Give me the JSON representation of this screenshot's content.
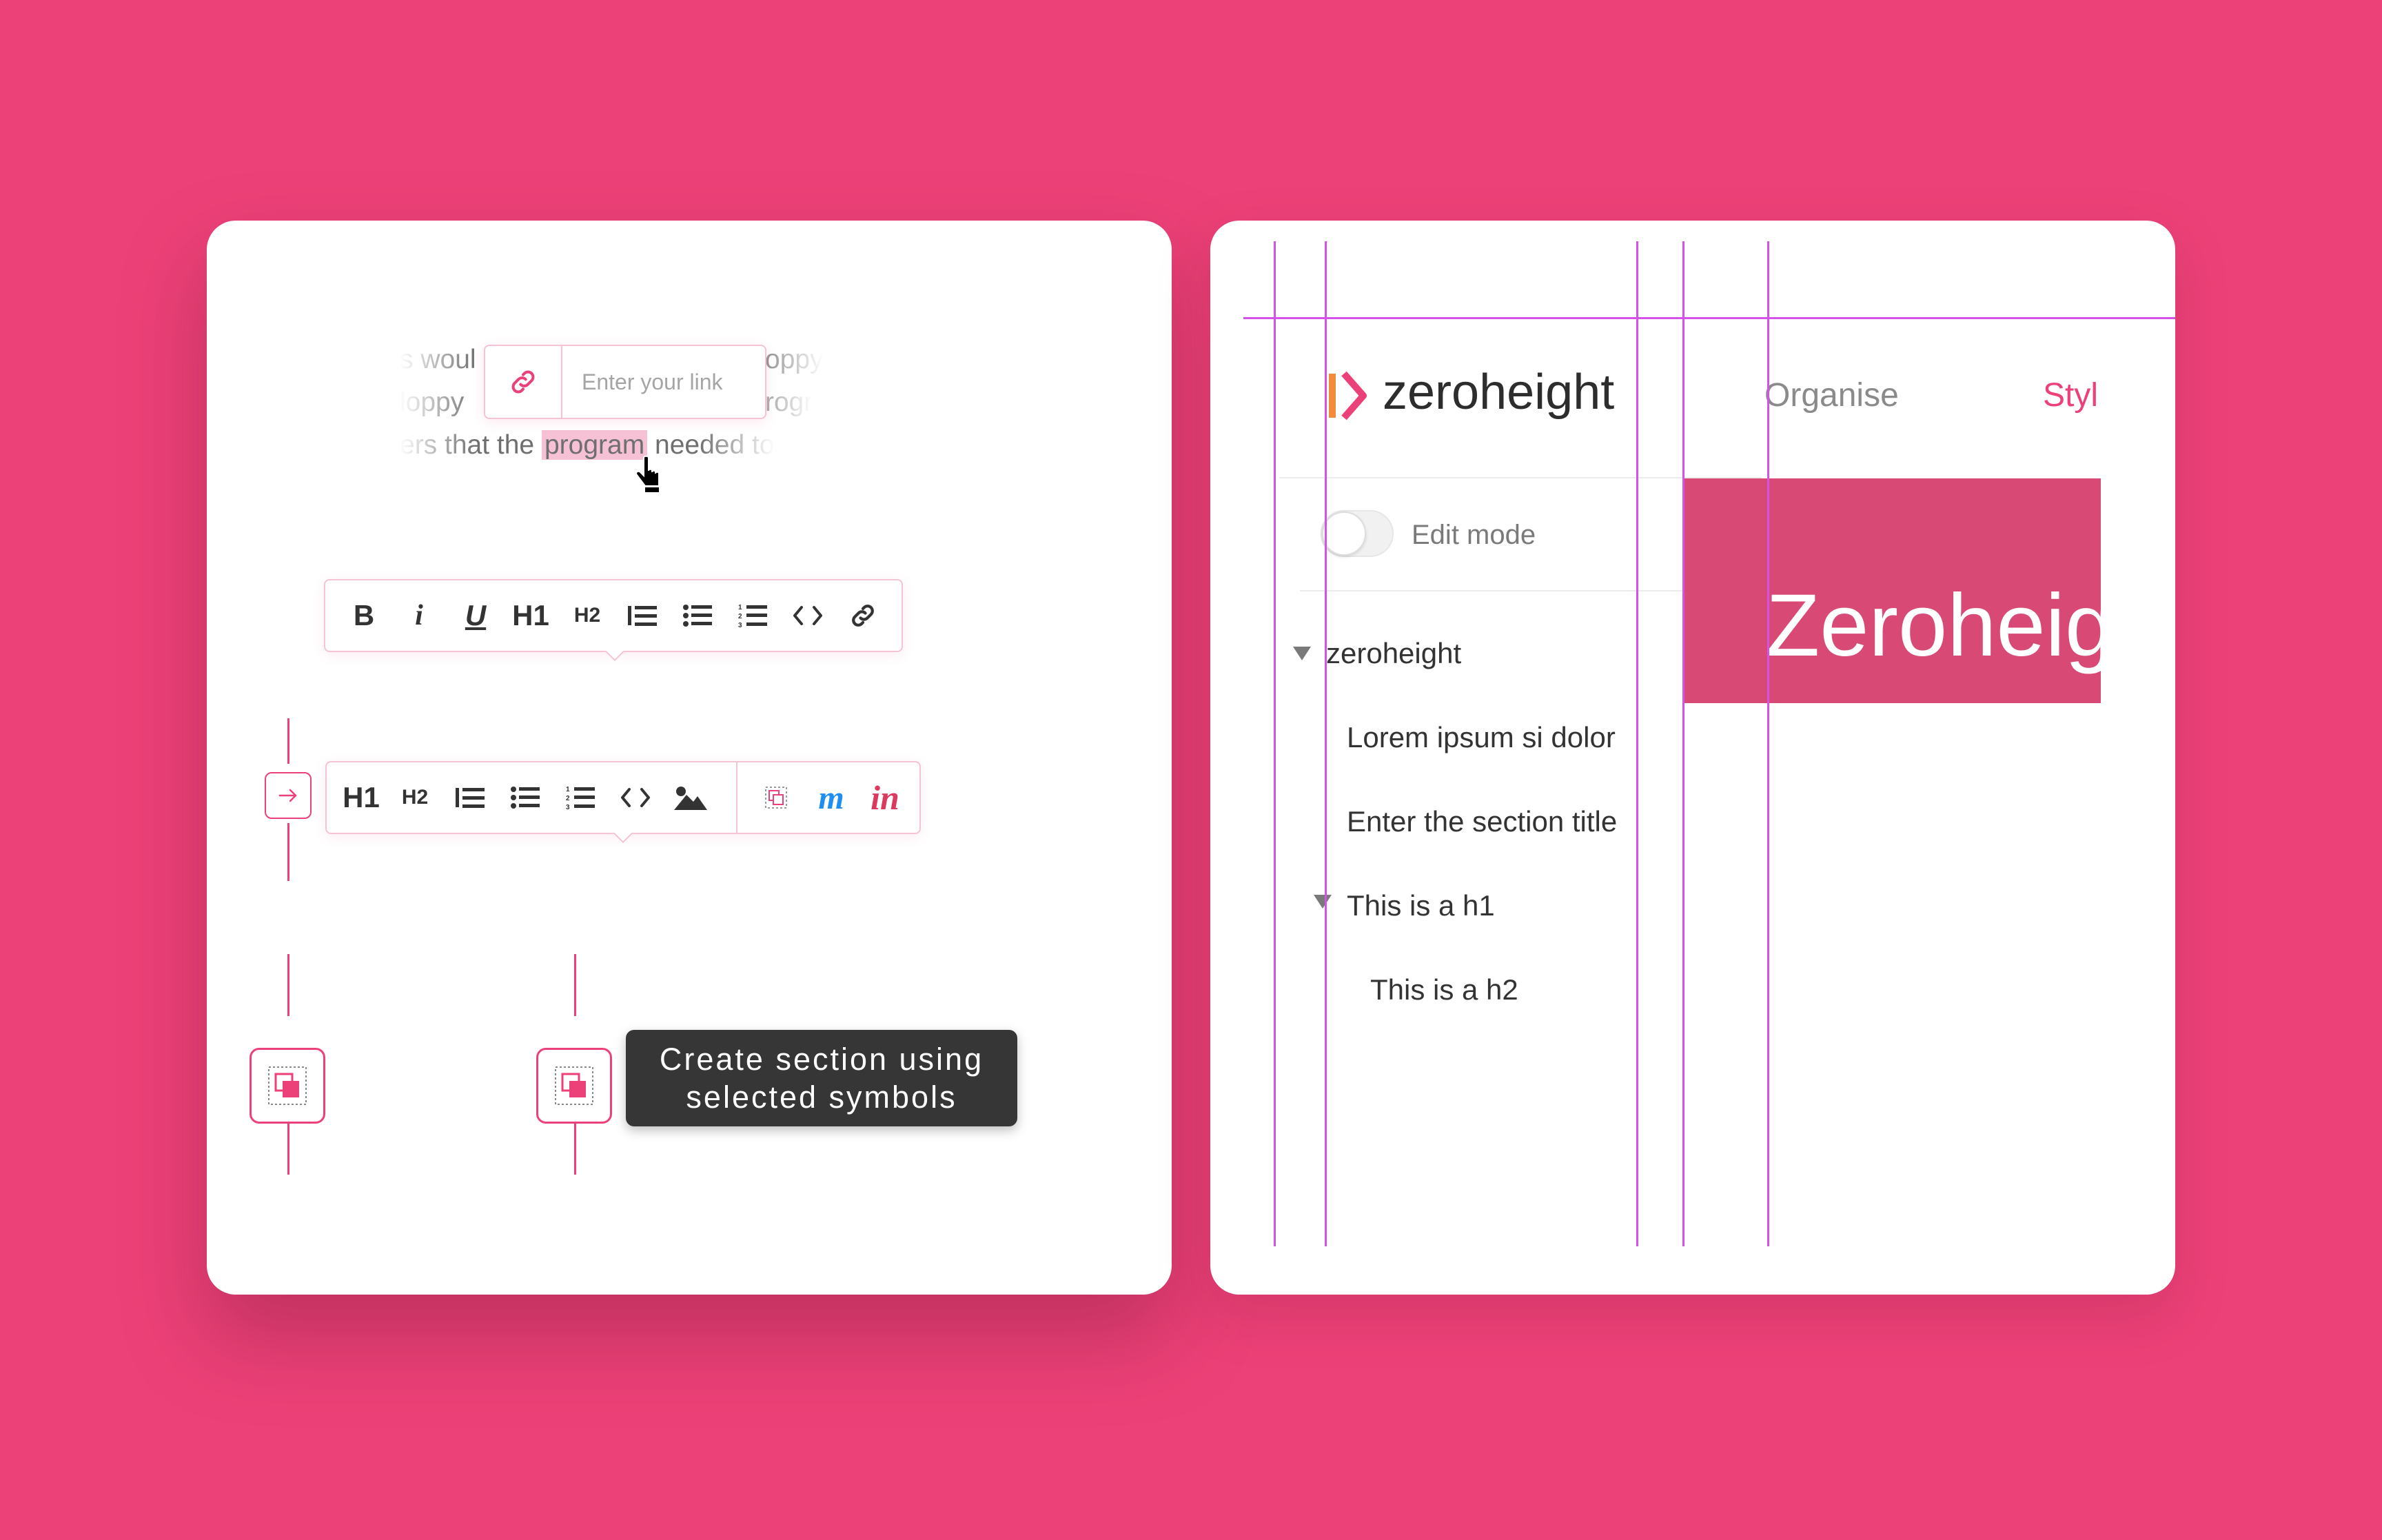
{
  "left_card": {
    "editor_text": {
      "line1_left": "s woul",
      "line1_right": "oppy",
      "line2_left": "loppy",
      "line2_right": "rogr",
      "line3_before": "ers that the",
      "line3_highlight": "program",
      "line3_after": "needed to"
    },
    "link_popover": {
      "placeholder": "Enter your link",
      "icon": "link-icon"
    },
    "formatting_toolbar": {
      "items": [
        {
          "label": "B",
          "icon": "bold-icon"
        },
        {
          "label": "i",
          "icon": "italic-icon"
        },
        {
          "label": "U",
          "icon": "underline-icon"
        },
        {
          "label": "H1",
          "icon": "heading1-icon"
        },
        {
          "label": "H2",
          "icon": "heading2-icon"
        },
        {
          "label": "",
          "icon": "quote-list-icon"
        },
        {
          "label": "",
          "icon": "bullet-list-icon"
        },
        {
          "label": "",
          "icon": "numbered-list-icon"
        },
        {
          "label": "",
          "icon": "code-icon"
        },
        {
          "label": "",
          "icon": "link-icon"
        }
      ]
    },
    "insert_toolbar": {
      "items": [
        {
          "label": "H1",
          "icon": "heading1-icon"
        },
        {
          "label": "H2",
          "icon": "heading2-icon"
        },
        {
          "label": "",
          "icon": "quote-list-icon"
        },
        {
          "label": "",
          "icon": "bullet-list-icon"
        },
        {
          "label": "",
          "icon": "numbered-list-icon"
        },
        {
          "label": "",
          "icon": "code-icon"
        },
        {
          "label": "",
          "icon": "image-icon"
        },
        {
          "label": "",
          "icon": "symbols-icon"
        },
        {
          "label": "",
          "icon": "marvel-icon"
        },
        {
          "label": "in",
          "icon": "invision-icon"
        }
      ]
    },
    "tooltip": {
      "line1": "Create section using",
      "line2": "selected symbols"
    }
  },
  "right_card": {
    "logo_text": "zeroheight",
    "nav": {
      "organise": "Organise",
      "style": "Styl"
    },
    "edit_mode_label": "Edit mode",
    "tree": {
      "root": "zeroheight",
      "items": [
        "Lorem ipsum si dolor",
        "Enter the section title",
        "This is a h1",
        "This is a h2"
      ]
    },
    "banner_text": "Zeroheight"
  },
  "colors": {
    "background": "#ec4178",
    "accent": "#ec4178",
    "guide": "#d552e6",
    "banner": "#d84a75",
    "tooltip": "#363636"
  }
}
